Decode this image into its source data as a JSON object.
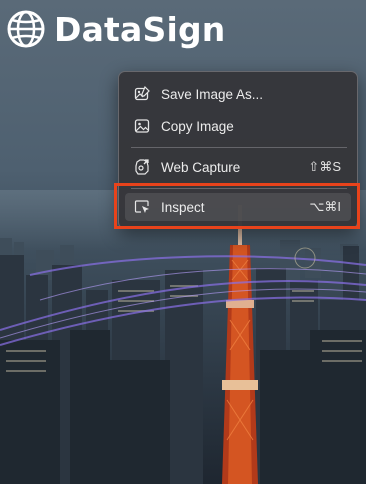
{
  "brand": {
    "name": "DataSign",
    "icon": "globe-icon"
  },
  "context_menu": {
    "items": [
      {
        "label": "Save Image As...",
        "icon": "save-image-icon",
        "shortcut": ""
      },
      {
        "label": "Copy Image",
        "icon": "image-icon",
        "shortcut": ""
      },
      {
        "label": "Web Capture",
        "icon": "web-capture-icon",
        "shortcut": "⇧⌘S"
      },
      {
        "label": "Inspect",
        "icon": "inspect-icon",
        "shortcut": "⌥⌘I"
      }
    ]
  },
  "colors": {
    "highlight_border": "#e8431b",
    "menu_bg": "#36363a"
  }
}
